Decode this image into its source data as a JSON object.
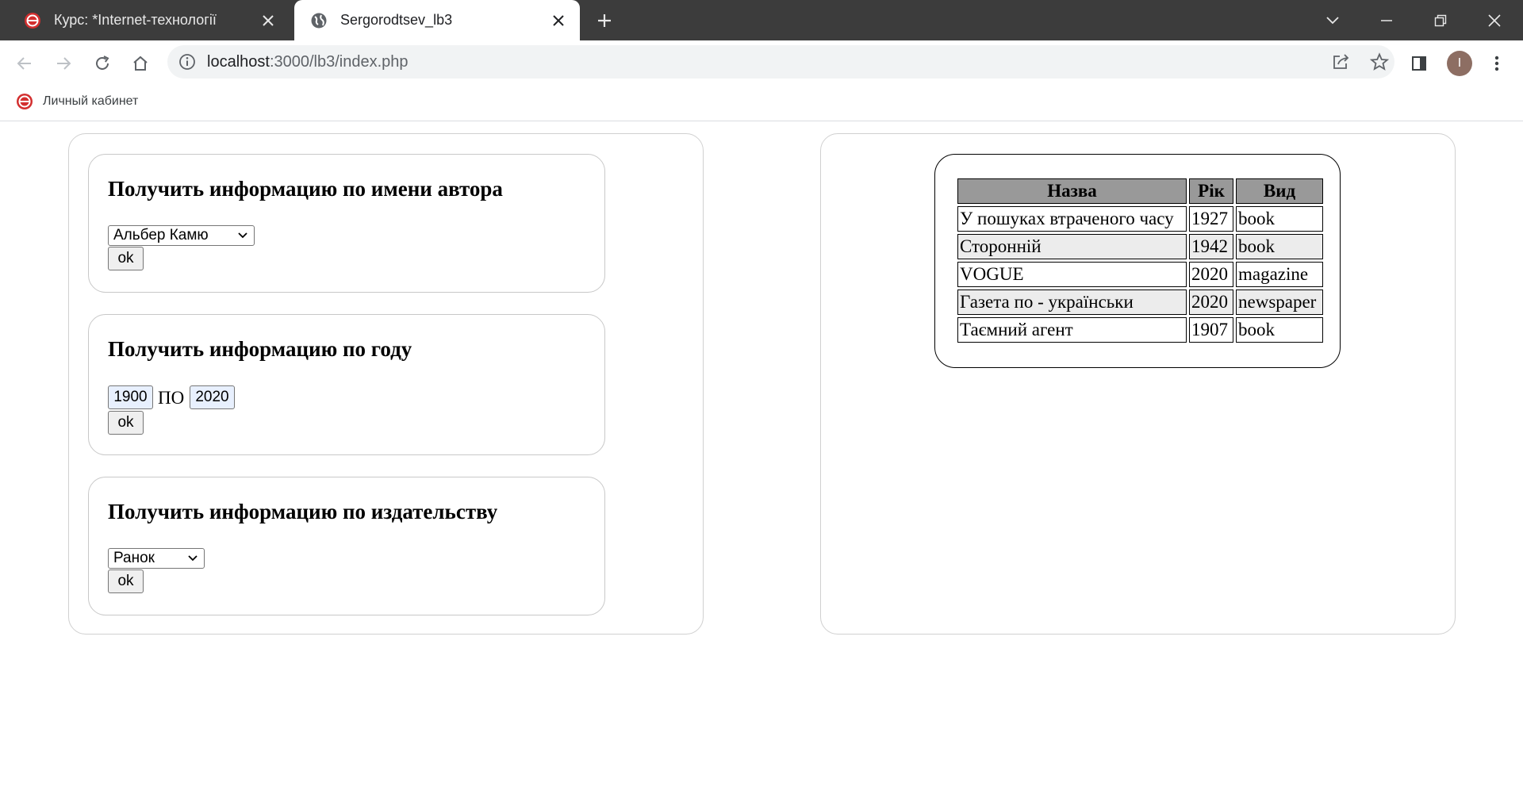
{
  "browser": {
    "tabs": [
      {
        "title": "Курс: *Internet-технології",
        "favicon": "site-logo-icon",
        "active": false
      },
      {
        "title": "Sergorodtsev_lb3",
        "favicon": "globe-icon",
        "active": true
      }
    ],
    "url_host": "localhost",
    "url_path": ":3000/lb3/index.php",
    "profile_initial": "I",
    "bookmarks": [
      {
        "label": "Личный кабинет",
        "icon": "site-logo-icon"
      }
    ],
    "colors": {
      "tabbar": "#3c3c3c",
      "omnibox": "#f1f3f4",
      "avatar": "#8d6e63",
      "logo": "#d32f2f"
    }
  },
  "page": {
    "author_form": {
      "title": "Получить информацию по имени автора",
      "selected": "Альбер Камю",
      "submit": "ok"
    },
    "year_form": {
      "title": "Получить информацию по году",
      "from": "1900",
      "separator": "ПО",
      "to": "2020",
      "submit": "ok"
    },
    "publisher_form": {
      "title": "Получить информацию по издательству",
      "selected": "Ранок",
      "submit": "ok"
    },
    "results": {
      "columns": [
        "Назва",
        "Рік",
        "Вид"
      ],
      "rows": [
        [
          "У пошуках втраченого часу",
          "1927",
          "book"
        ],
        [
          "Сторонній",
          "1942",
          "book"
        ],
        [
          "VOGUE",
          "2020",
          "magazine"
        ],
        [
          "Газета по - українськи",
          "2020",
          "newspaper"
        ],
        [
          "Таємний агент",
          "1907",
          "book"
        ]
      ],
      "colors": {
        "header_bg": "#999999",
        "even_row_bg": "#ececec"
      }
    }
  }
}
